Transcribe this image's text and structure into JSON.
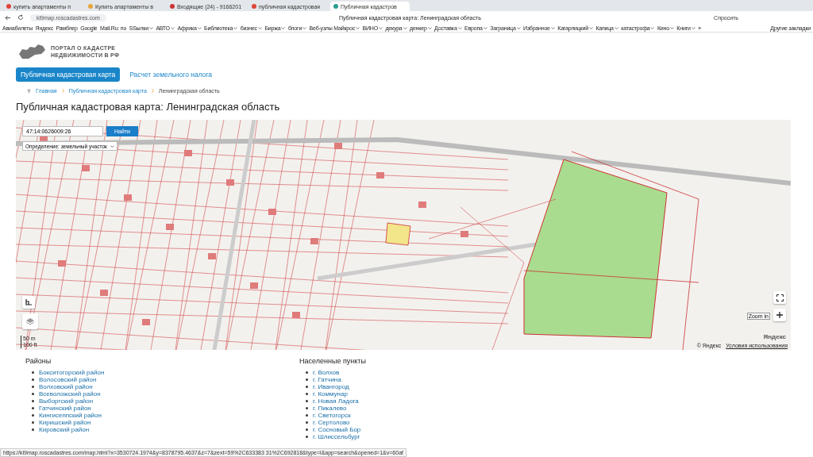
{
  "browser": {
    "tabs": [
      {
        "title": "купить апартаменты п",
        "selected": false
      },
      {
        "title": "Купить апартаменты в",
        "selected": false
      },
      {
        "title": "Входящие (24) - 9166201",
        "selected": false
      },
      {
        "title": "публичная кадастровая",
        "selected": false
      },
      {
        "title": "Публичная кадастров",
        "selected": true
      }
    ],
    "address": "kl9map.roscadastres.com",
    "page_title": "Публичная кадастровая карта: Ленинградская область",
    "ask_button": "Спросить",
    "bookmarks": [
      {
        "label": "Авиабилеты",
        "folder": false
      },
      {
        "label": "Яндекс",
        "folder": false
      },
      {
        "label": "Рамблер",
        "folder": false
      },
      {
        "label": "Google",
        "folder": false
      },
      {
        "label": "Mail.Ru: по",
        "folder": false
      },
      {
        "label": "SSылки",
        "folder": true
      },
      {
        "label": "АВТО",
        "folder": true
      },
      {
        "label": "Африка",
        "folder": true
      },
      {
        "label": "Библиотека",
        "folder": true
      },
      {
        "label": "бизнес",
        "folder": true
      },
      {
        "label": "Биржа",
        "folder": true
      },
      {
        "label": "блоги",
        "folder": true
      },
      {
        "label": "Веб-узлы Майкрос",
        "folder": true
      },
      {
        "label": "ВИНО",
        "folder": true
      },
      {
        "label": "декура",
        "folder": true
      },
      {
        "label": "денкер",
        "folder": true
      },
      {
        "label": "Доставка",
        "folder": true
      },
      {
        "label": "Европа",
        "folder": true
      },
      {
        "label": "Заграница",
        "folder": true
      },
      {
        "label": "Избранное",
        "folder": true
      },
      {
        "label": "Кагарлицкий",
        "folder": true
      },
      {
        "label": "Капица",
        "folder": true
      },
      {
        "label": "катастрофа",
        "folder": true
      },
      {
        "label": "Кино",
        "folder": true
      },
      {
        "label": "Книги",
        "folder": true
      }
    ],
    "more_bookmarks": "»",
    "other_bookmarks": "Другие закладки"
  },
  "logo": {
    "line1": "ПОРТАЛ О КАДАСТРЕ",
    "line2": "НЕДВИЖИМОСТИ В РФ"
  },
  "nav": [
    {
      "label": "Публичная кадастровая карта",
      "selected": true
    },
    {
      "label": "Расчет земельного налога",
      "selected": false
    }
  ],
  "breadcrumbs": [
    "Главная",
    "Публичная кадастровая карта",
    "Ленинградская область"
  ],
  "title": "Публичная кадастровая карта: Ленинградская область",
  "map": {
    "search_value": "47:14:0626009:26",
    "search_button": "Найти",
    "mode_select": "Определение: земельный участок",
    "scale": [
      "50 m",
      "100 ft"
    ],
    "zoom_tooltip": "Zoom in",
    "yandex_logo": "Яндекс",
    "copyright": "© Яндекс",
    "terms_link": "Условия использования"
  },
  "districts": {
    "heading": "Районы",
    "items": [
      "Бокситогорский район",
      "Волосовский район",
      "Волховский район",
      "Всеволожский район",
      "Выборгский район",
      "Гатчинский район",
      "Кингисеппский район",
      "Киришский район",
      "Кировский район"
    ]
  },
  "settlements": {
    "heading": "Населенные пункты",
    "items": [
      "г. Волхов",
      "г. Гатчина",
      "г. Ивангород",
      "г. Коммунар",
      "г. Новая Ладога",
      "г. Пикалево",
      "г. Светогорск",
      "г. Сертолово",
      "г. Сосновый Бор",
      "г. Шлиссельбург"
    ]
  },
  "status_url": "https://kl9map.roscadastres.com/map.html?x=3530724.1974&y=8378795.4637&z=7&zext=59%2C633383 31%2C692818&type=l&app=search&opened=1&v=60af"
}
